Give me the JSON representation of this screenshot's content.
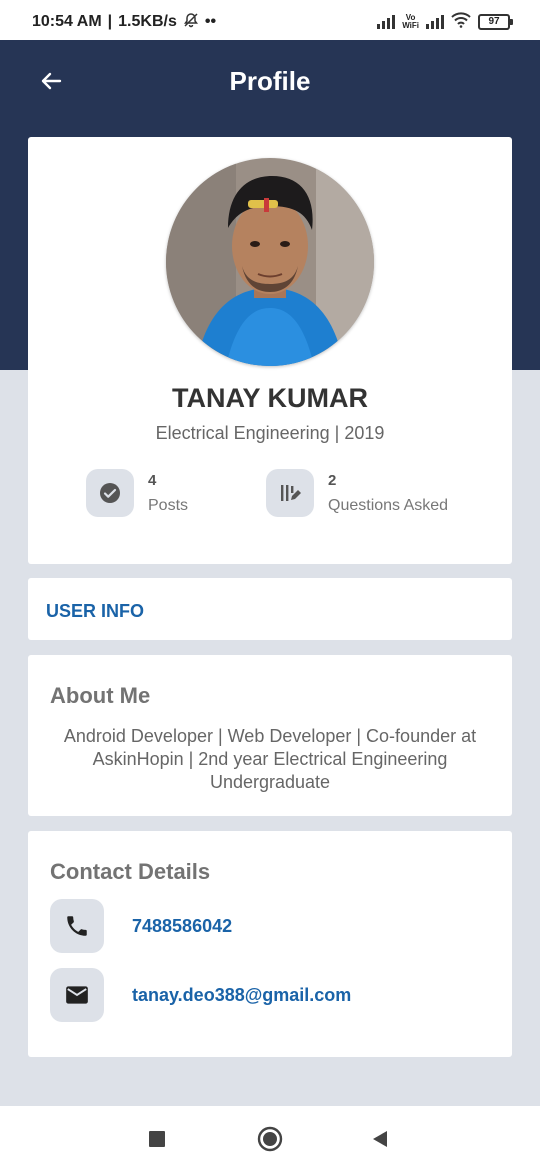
{
  "status_bar": {
    "time": "10:54 AM",
    "speed": "1.5KB/s",
    "vowifi_top": "Vo",
    "vowifi_bottom": "WiFi",
    "battery": "97",
    "alarm_icon": "alarm-off-icon",
    "dots": "••"
  },
  "header": {
    "title": "Profile",
    "back_icon": "arrow-left-icon"
  },
  "profile": {
    "name": "TANAY KUMAR",
    "department": "Electrical Engineering | 2019",
    "stats": [
      {
        "value": "4",
        "label": "Posts",
        "icon": "check-circle-icon"
      },
      {
        "value": "2",
        "label": "Questions Asked",
        "icon": "edit-note-icon"
      }
    ]
  },
  "user_info": {
    "label": "USER INFO"
  },
  "about": {
    "title": "About Me",
    "text": "Android Developer | Web Developer | Co-founder at AskinHopin | 2nd year Electrical Engineering Undergraduate"
  },
  "contact": {
    "title": "Contact Details",
    "phone": "7488586042",
    "email": "tanay.deo388@gmail.com"
  },
  "colors": {
    "header_bg": "#263555",
    "page_bg": "#dde1e8",
    "link": "#1a63a8"
  }
}
